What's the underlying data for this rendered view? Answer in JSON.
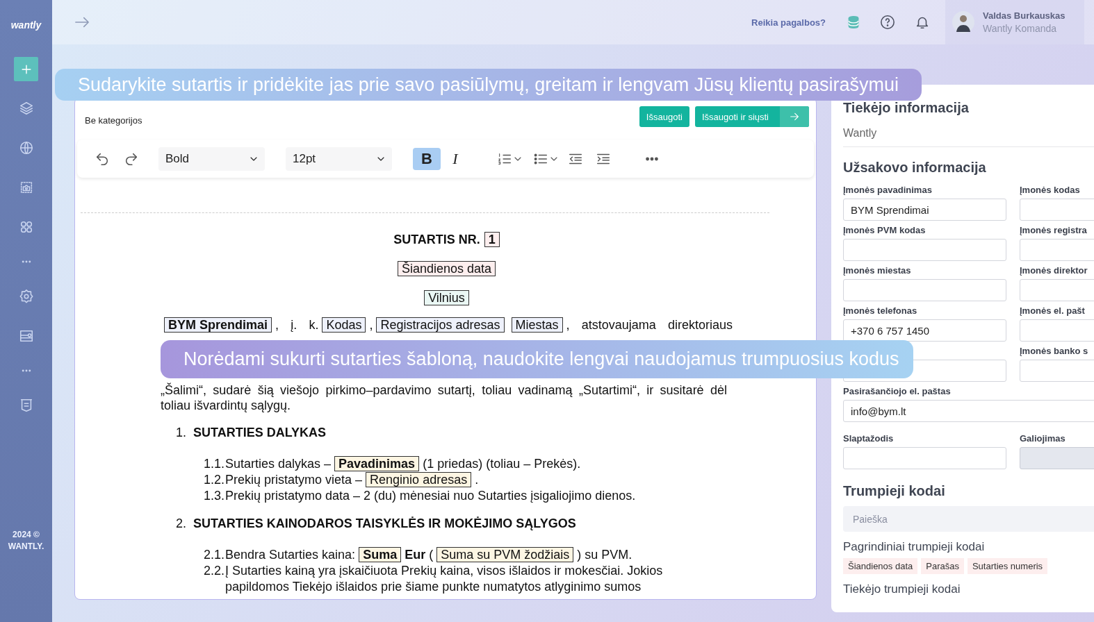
{
  "sidebar": {
    "logo": "wantly",
    "footer": "2024 © WANTLY."
  },
  "topbar": {
    "help_link": "Reikia pagalbos?",
    "user": {
      "name": "Valdas Burkauskas",
      "team": "Wantly Komanda"
    }
  },
  "editor": {
    "category": "Be kategorijos",
    "buttons": [
      {
        "label": "Išsaugoti",
        "kind": "save"
      },
      {
        "label": "Išsaugoti ir siųsti",
        "kind": "send"
      }
    ],
    "toolbar": {
      "font_style": "Bold",
      "font_size": "12pt",
      "format_buttons": [
        {
          "label": "B",
          "kind": "bold",
          "on": true
        },
        {
          "label": "I",
          "kind": "italic",
          "on": false
        }
      ]
    },
    "document": {
      "blocks": [
        {
          "kind": "title",
          "segments": [
            {
              "kind": "text",
              "text": "SUTARTIS NR.",
              "bold": true
            },
            {
              "kind": "chip",
              "text": "1",
              "bold": true,
              "color": "#fdeeee"
            }
          ]
        },
        {
          "kind": "center",
          "segments": [
            {
              "kind": "chip",
              "text": "Šiandienos data",
              "bold": false,
              "color": "#fdeeee"
            }
          ]
        },
        {
          "kind": "center",
          "segments": [
            {
              "kind": "chip",
              "text": "Vilnius",
              "bold": false,
              "color": "#eaf7f4"
            }
          ]
        },
        {
          "kind": "intro",
          "segments": [
            {
              "kind": "chip",
              "text": "BYM Sprendimai",
              "bold": true,
              "color": "#eef1fb"
            },
            {
              "kind": "text",
              "text": ", į. k.",
              "bold": false
            },
            {
              "kind": "chip",
              "text": "Kodas",
              "bold": false,
              "color": "#eef1fb"
            },
            {
              "kind": "text",
              "text": ",",
              "bold": false
            },
            {
              "kind": "chip",
              "text": "Registracijos adresas",
              "bold": false,
              "color": "#eef1fb"
            },
            {
              "kind": "chip",
              "text": "Miestas",
              "bold": false,
              "color": "#eef1fb"
            },
            {
              "kind": "text",
              "text": ", atstovaujama direktoriaus",
              "bold": false
            }
          ]
        },
        {
          "kind": "paragraph",
          "segments": [
            {
              "kind": "text",
              "text": "„Šalimi“, sudarė šią viešojo pirkimo–pardavimo sutartį, toliau vadinamą „Sutartimi“, ir susitarė dėl toliau išvardintų sąlygų.",
              "bold": false
            }
          ]
        },
        {
          "kind": "heading",
          "number": "1.",
          "segments": [
            {
              "kind": "text",
              "text": "SUTARTIES DALYKAS",
              "bold": true
            }
          ]
        },
        {
          "kind": "item",
          "number": "1.1.",
          "segments": [
            {
              "kind": "text",
              "text": "Sutarties dalykas –",
              "bold": false
            },
            {
              "kind": "chip",
              "text": "Pavadinimas",
              "bold": true,
              "color": "#fdf6e3"
            },
            {
              "kind": "text",
              "text": "(1 priedas) (toliau – Prekės).",
              "bold": false
            }
          ]
        },
        {
          "kind": "item",
          "number": "1.2.",
          "segments": [
            {
              "kind": "text",
              "text": "Prekių pristatymo vieta –",
              "bold": false
            },
            {
              "kind": "chip",
              "text": "Renginio adresas",
              "bold": false,
              "color": "#fdf6e3"
            },
            {
              "kind": "text",
              "text": ".",
              "bold": false
            }
          ]
        },
        {
          "kind": "item",
          "number": "1.3.",
          "segments": [
            {
              "kind": "text",
              "text": "Prekių pristatymo data – 2 (du) mėnesiai nuo Sutarties įsigaliojimo dienos.",
              "bold": false
            }
          ]
        },
        {
          "kind": "heading",
          "number": "2.",
          "segments": [
            {
              "kind": "text",
              "text": "SUTARTIES KAINODAROS TAISYKLĖS IR MOKĖJIMO SĄLYGOS",
              "bold": true
            }
          ]
        },
        {
          "kind": "item",
          "number": "2.1.",
          "segments": [
            {
              "kind": "text",
              "text": "Bendra Sutarties kaina:",
              "bold": false
            },
            {
              "kind": "chip",
              "text": "Suma",
              "bold": true,
              "color": "#fdf6e3"
            },
            {
              "kind": "text",
              "text": "**Eur** (",
              "bold": false
            },
            {
              "kind": "chip",
              "text": "Suma su PVM žodžiais",
              "bold": false,
              "color": "#fdf6e3"
            },
            {
              "kind": "text",
              "text": ") su PVM.",
              "bold": false
            }
          ]
        },
        {
          "kind": "item",
          "number": "2.2.",
          "segments": [
            {
              "kind": "text",
              "text": "Į Sutarties kainą yra įskaičiuota Prekių kaina, visos išlaidos ir mokesčiai. Jokios papildomos Tiekėjo išlaidos prie šiame punkte numatytos atlyginimo sumos",
              "bold": false
            }
          ]
        }
      ]
    }
  },
  "supplier": {
    "title": "Tiekėjo informacija",
    "name": "Wantly"
  },
  "customer": {
    "title": "Užsakovo informacija",
    "fields": [
      {
        "kind": "half",
        "label": "Įmonės pavadinimas",
        "value": "BYM Sprendimai",
        "disabled": false
      },
      {
        "kind": "half",
        "label": "Įmonės kodas",
        "disabled": false
      },
      {
        "kind": "half",
        "label": "Įmonės PVM kodas",
        "disabled": false
      },
      {
        "kind": "half",
        "label": "Įmonės registra",
        "disabled": false
      },
      {
        "kind": "half",
        "label": "Įmonės miestas",
        "disabled": false
      },
      {
        "kind": "half",
        "label": "Įmonės direktor",
        "disabled": false
      },
      {
        "kind": "half",
        "label": "Įmonės telefonas",
        "value": "+370 6 757 1450",
        "disabled": false
      },
      {
        "kind": "half",
        "label": "Įmonės el. pašt",
        "disabled": false
      },
      {
        "kind": "half",
        "disabled": false
      },
      {
        "kind": "half",
        "label": "Įmonės banko s",
        "disabled": false
      },
      {
        "kind": "wide",
        "label": "Pasirašančiojo el. paštas",
        "value": "info@bym.lt",
        "disabled": false
      },
      {
        "kind": "half",
        "label": "Slaptažodis",
        "disabled": false
      },
      {
        "kind": "half",
        "label": "Galiojimas",
        "disabled": true
      }
    ]
  },
  "shortcodes": {
    "title": "Trumpieji kodai",
    "search_placeholder": "Paieška",
    "groups": [
      {
        "title": "Pagrindiniai trumpieji kodai",
        "tags": [
          "Šiandienos data",
          "Parašas",
          "Sutarties numeris"
        ]
      },
      {
        "title": "Tiekėjo trumpieji kodai"
      }
    ]
  },
  "banners": [
    {
      "text": "Sudarykite sutartis ir pridėkite jas prie savo pasiūlymų, greitam ir lengvam Jūsų klientų pasirašymui"
    },
    {
      "text": "Norėdami sukurti sutarties šabloną, naudokite lengvai naudojamus trumpuosius kodus"
    }
  ]
}
